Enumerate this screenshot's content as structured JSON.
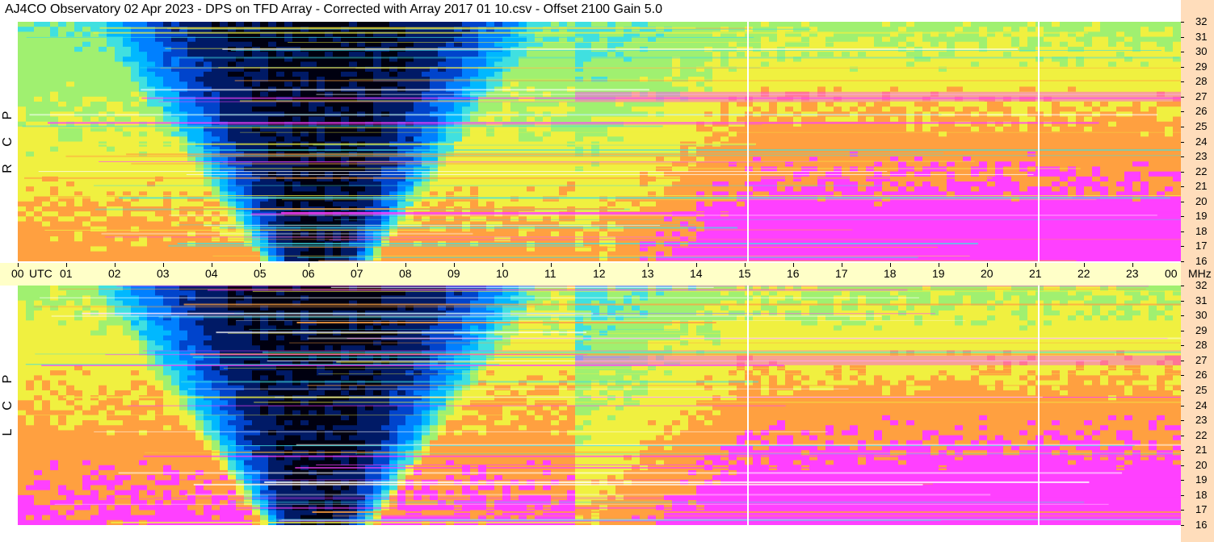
{
  "title": "AJ4CO Observatory  02 Apr 2023  -  DPS on TFD Array  -  Corrected with Array 2017 01 10.csv  -  Offset 2100  Gain 5.0",
  "chart_data": {
    "type": "heatmap",
    "title": "AJ4CO Observatory  02 Apr 2023  -  DPS on TFD Array  -  Corrected with Array 2017 01 10.csv  -  Offset 2100  Gain 5.0",
    "x_unit_label": "UTC",
    "y_unit_label": "MHz",
    "x_ticks": [
      "00",
      "01",
      "02",
      "03",
      "04",
      "05",
      "06",
      "07",
      "08",
      "09",
      "10",
      "11",
      "12",
      "13",
      "14",
      "15",
      "16",
      "17",
      "18",
      "19",
      "20",
      "21",
      "22",
      "23",
      "00"
    ],
    "x_range_hours": [
      0,
      24
    ],
    "y_ticks": [
      "16",
      "17",
      "18",
      "19",
      "20",
      "21",
      "22",
      "23",
      "24",
      "25",
      "26",
      "27",
      "28",
      "29",
      "30",
      "31",
      "32"
    ],
    "y_range_mhz": [
      16,
      32
    ],
    "panels": [
      {
        "polarization": "RCP",
        "label_letters": [
          "R",
          "C",
          "P"
        ]
      },
      {
        "polarization": "LCP",
        "label_letters": [
          "L",
          "C",
          "P"
        ]
      }
    ],
    "colormap": [
      "#000010",
      "#001a66",
      "#0044cc",
      "#0080ff",
      "#00b8ff",
      "#40e0e0",
      "#a0f070",
      "#f0f040",
      "#ffa040",
      "#ff40ff",
      "#ffffff"
    ],
    "vertical_marks_utc": [
      15.05,
      21.05
    ]
  }
}
